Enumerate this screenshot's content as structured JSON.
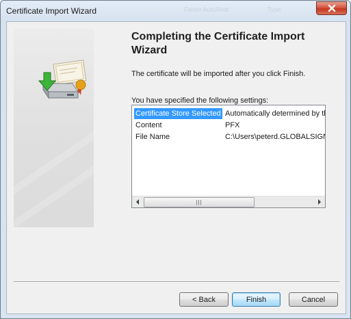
{
  "window": {
    "title": "Certificate Import Wizard",
    "faint_title_left": "Folder AutoRoot",
    "faint_title_right": "Type"
  },
  "heading": "Completing the Certificate Import Wizard",
  "lead_text": "The certificate will be imported after you click Finish.",
  "settings_label": "You have specified the following settings:",
  "settings": [
    {
      "name": "Certificate Store Selected",
      "value": "Automatically determined by the wizard",
      "selected": true
    },
    {
      "name": "Content",
      "value": "PFX",
      "selected": false
    },
    {
      "name": "File Name",
      "value": "C:\\Users\\peterd.GLOBALSIGN\\Desktop\\certificate.pfx",
      "selected": false
    }
  ],
  "scrollbar": {
    "left_icon": "arrow-left-icon",
    "right_icon": "arrow-right-icon",
    "grip": "|||"
  },
  "buttons": {
    "back": "< Back",
    "finish": "Finish",
    "cancel": "Cancel"
  },
  "icons": {
    "close": "close-icon",
    "wizard": "certificate-install-icon"
  },
  "colors": {
    "selection": "#3399ff",
    "close_button": "#c4371f",
    "default_button_border": "#3c7fb1"
  }
}
